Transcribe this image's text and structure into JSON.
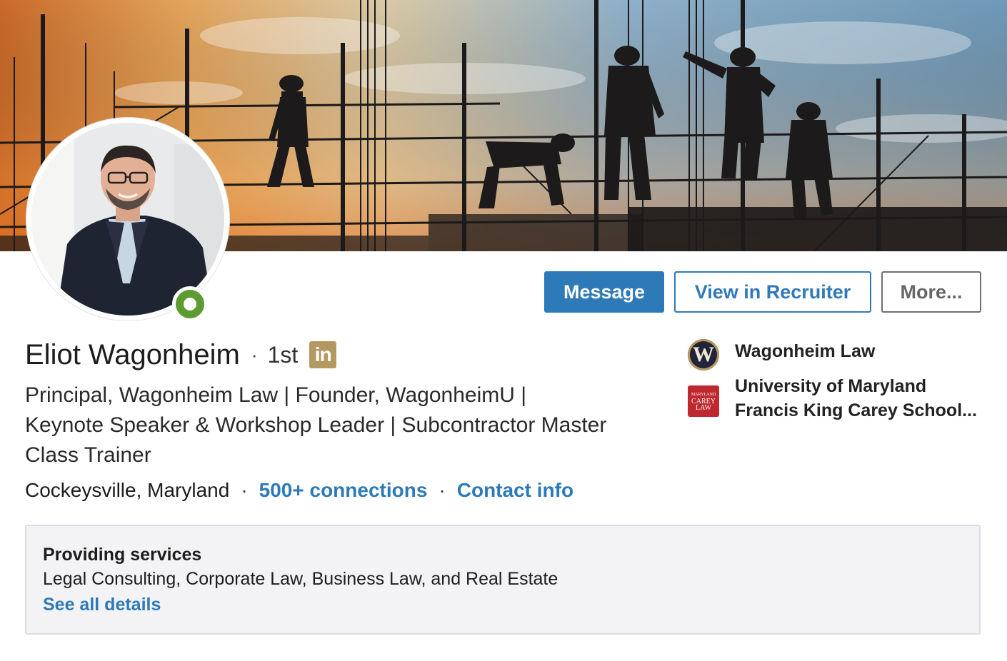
{
  "profile": {
    "name": "Eliot Wagonheim",
    "degree_separator": "·",
    "degree": "1st",
    "badge_text": "in",
    "headline": "Principal, Wagonheim Law | Founder, WagonheimU | Keynote Speaker & Workshop Leader | Subcontractor Master Class Trainer",
    "location": "Cockeysville, Maryland",
    "connections": "500+ connections",
    "contact_info": "Contact info",
    "dot": "·"
  },
  "actions": {
    "message": "Message",
    "recruiter": "View in Recruiter",
    "more": "More..."
  },
  "experience": [
    {
      "name": "Wagonheim Law",
      "logo_letter": "W"
    },
    {
      "name": "University of Maryland Francis King Carey School...",
      "logo_lines": [
        "MARYLAND",
        "CAREY",
        "LAW"
      ]
    }
  ],
  "services": {
    "title": "Providing services",
    "list": "Legal Consulting, Corporate Law, Business Law, and Real Estate",
    "link": "See all details"
  },
  "colors": {
    "primary": "#2e7ab8",
    "online_status": "#5d9a31",
    "linkedin_badge": "#b49861",
    "school_logo": "#c0282f"
  }
}
